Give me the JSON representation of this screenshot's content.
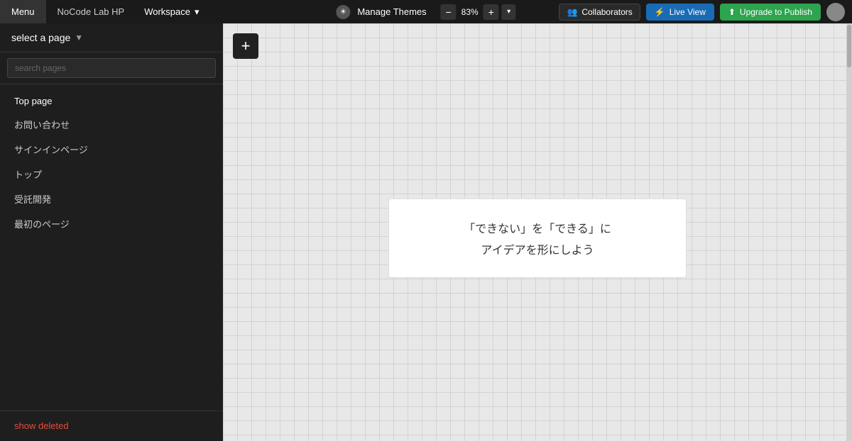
{
  "topbar": {
    "menu_label": "Menu",
    "app_name": "NoCode Lab HP",
    "workspace_label": "Workspace",
    "workspace_chevron": "▾",
    "theme_icon": "☀",
    "manage_themes_label": "Manage Themes",
    "zoom_minus": "−",
    "zoom_value": "83%",
    "zoom_plus": "+",
    "zoom_dropdown": "▾",
    "collaborators_label": "Collaborators",
    "live_view_label": "Live View",
    "publish_label": "Upgrade to Publish"
  },
  "sidebar": {
    "select_page_label": "select a page",
    "chevron": "▼",
    "search_placeholder": "search pages",
    "pages": [
      {
        "label": "Top page",
        "active": true
      },
      {
        "label": "お問い合わせ",
        "active": false
      },
      {
        "label": "サインインページ",
        "active": false
      },
      {
        "label": "トップ",
        "active": false
      },
      {
        "label": "受託開発",
        "active": false
      },
      {
        "label": "最初のページ",
        "active": false
      }
    ],
    "show_deleted_label": "show deleted"
  },
  "canvas": {
    "add_block_label": "+",
    "content_line1": "「できない」を「できる」に",
    "content_line2": "アイデアを形にしよう"
  }
}
